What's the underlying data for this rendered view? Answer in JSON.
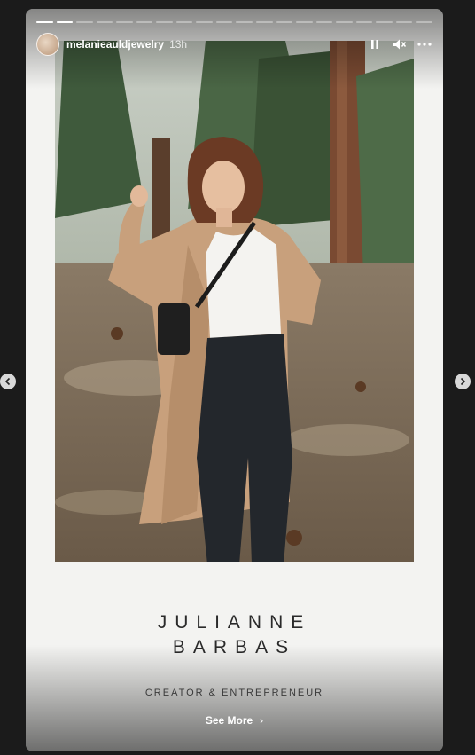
{
  "story": {
    "username": "melanieauldjewelry",
    "time": "13h",
    "segments": [
      1,
      1,
      0,
      0,
      0,
      0,
      0,
      0,
      0,
      0,
      0,
      0,
      0,
      0,
      0,
      0,
      0,
      0,
      0,
      0
    ],
    "controls": {
      "pause_icon": "pause-icon",
      "mute_icon": "mute-icon",
      "more_icon": "more-icon"
    }
  },
  "content": {
    "name_line1": "JULIANNE",
    "name_line2": "BARBAS",
    "subtitle": "CREATOR & ENTREPRENEUR",
    "see_more": "See More",
    "see_more_chevron": "›"
  },
  "nav": {
    "prev_icon": "chevron-left-icon",
    "next_icon": "chevron-right-icon"
  }
}
